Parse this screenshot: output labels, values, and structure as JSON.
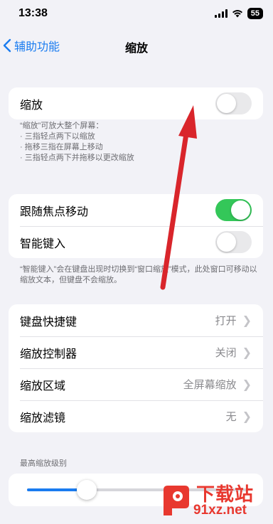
{
  "status_bar": {
    "time": "13:38",
    "battery": "55"
  },
  "nav": {
    "back_label": "辅助功能",
    "title": "缩放"
  },
  "zoom_group": {
    "label": "缩放",
    "toggle_on": false,
    "footer_lines": [
      "“缩放”可放大整个屏幕：",
      "· 三指轻点两下以缩放",
      "· 拖移三指在屏幕上移动",
      "· 三指轻点两下并拖移以更改缩放"
    ]
  },
  "focus_group": {
    "items": [
      {
        "label": "跟随焦点移动",
        "toggle_on": true
      },
      {
        "label": "智能键入",
        "toggle_on": false
      }
    ],
    "footer": "“智能键入”会在键盘出现时切换到“窗口缩放”模式，此处窗口可移动以缩放文本，但键盘不会缩放。"
  },
  "options_group": {
    "items": [
      {
        "label": "键盘快捷键",
        "value": "打开"
      },
      {
        "label": "缩放控制器",
        "value": "关闭"
      },
      {
        "label": "缩放区域",
        "value": "全屏幕缩放"
      },
      {
        "label": "缩放滤镜",
        "value": "无"
      }
    ]
  },
  "max_zoom": {
    "header": "最高缩放级别",
    "level": 0.27
  },
  "watermark": {
    "line1": "下载站",
    "line2": "91xz.net"
  },
  "colors": {
    "accent": "#1a7cf0",
    "toggle_on": "#34c759",
    "arrow": "#d9252b"
  },
  "icons": {
    "back": "chevron-left-icon",
    "row_chevron": "chevron-right-icon"
  }
}
